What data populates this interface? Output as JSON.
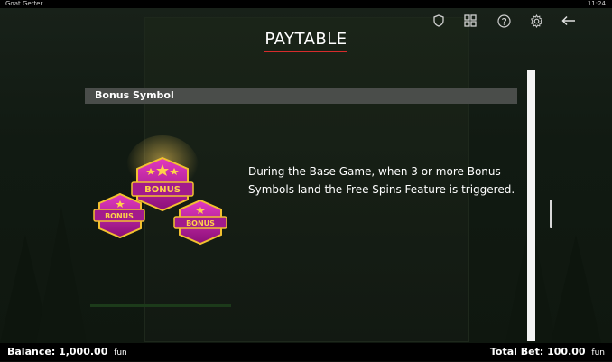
{
  "window": {
    "title": "Goat Getter",
    "time": "11:24"
  },
  "header": {
    "icons": [
      "shield-icon",
      "grid-icon",
      "help-icon",
      "settings-icon",
      "back-arrow-icon"
    ]
  },
  "page": {
    "title": "PAYTABLE"
  },
  "section": {
    "heading": "Bonus Symbol",
    "description": "During the Base Game, when 3 or more Bonus Symbols land the Free Spins Feature is triggered.",
    "symbol_label": "BONUS"
  },
  "footer": {
    "balance_label": "Balance:",
    "balance_value": "1,000.00",
    "balance_currency": "fun",
    "bet_label": "Total Bet:",
    "bet_value": "100.00",
    "bet_currency": "fun"
  },
  "colors": {
    "accent_underline": "#d62c2c",
    "section_bar": "#4a4d4a",
    "bonus_pink": "#c0199a",
    "bonus_gold": "#f2c030"
  }
}
